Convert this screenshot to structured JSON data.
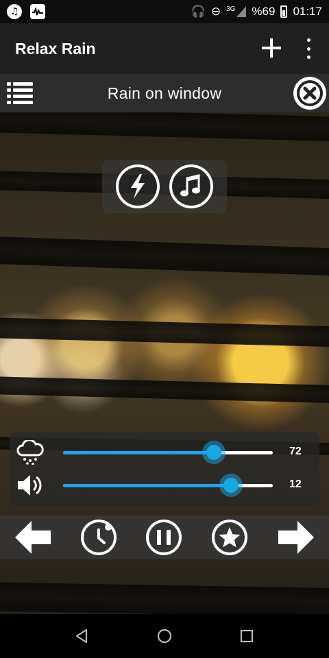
{
  "status_bar": {
    "left_icons": [
      "music-notification-icon",
      "activity-notification-icon"
    ],
    "headphones_glyph": "🎧",
    "dnd_glyph": "⊖",
    "network": "3G",
    "battery": "%69",
    "time": "01:17"
  },
  "app_bar": {
    "title": "Relax Rain"
  },
  "sound_bar": {
    "title": "Rain on window"
  },
  "sliders": {
    "rain": {
      "value": "72",
      "level": 0.72,
      "icon": "rain-cloud-icon"
    },
    "volume": {
      "value": "12",
      "level": 0.8,
      "icon": "speaker-icon"
    }
  },
  "controls": [
    "back-arrow-icon",
    "timer-icon",
    "pause-icon",
    "star-icon",
    "forward-arrow-icon"
  ],
  "colors": {
    "accent": "#1aa7e0",
    "app_bar": "#202020",
    "sound_bar": "#2d2d2d"
  }
}
